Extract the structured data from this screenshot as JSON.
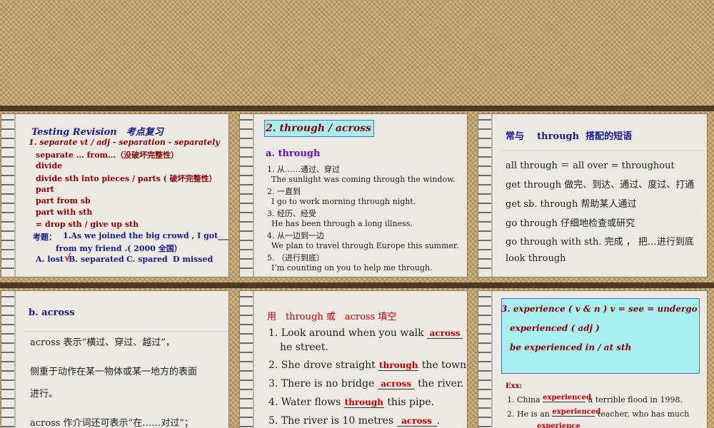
{
  "slides": {
    "s1": {
      "title": "Testing Revision　考点复习",
      "line1": "1. separate vt  / adj     - separation - separately",
      "line2": "separate … from…（没破坏完整性）",
      "line3": "divide",
      "line4": "divide sth into pieces / parts ( 破坏完整性）",
      "line5": "part",
      "line6": "part from sb",
      "line7": "part with sth",
      "line8": "= drop sth / give up sth",
      "q_label": "考题：",
      "q_text": "1.As we joined the big crowd , I got______",
      "q_text2": "from my friend .( 2000  全国）",
      "options": [
        "A. lost",
        "B. separated",
        "C. spared",
        "D missed"
      ],
      "check": "√"
    },
    "s2": {
      "title": "2. through / across",
      "sub": "a.  through",
      "items": [
        "1.  从……通过、穿过",
        "The sunlight was coming through the window.",
        "2.  一直到",
        "I go to work morning through night.",
        "3.  经历、经受",
        "He has been through a long illness.",
        "4.  从一边到一边",
        "We plan to travel through Europe this summer.",
        "5.  （进行到底）",
        "I’m counting on you to help me through."
      ]
    },
    "s3": {
      "title_a": "常与",
      "title_b": "through",
      "title_c": "搭配的短语",
      "items": [
        "all through ＝ all over = throughout",
        "get through  做完、到达、通过、度过、打通",
        "get sb. through  帮助某人通过",
        "go through  仔细地检查或研究",
        "go through with sth.  完成 ， 把…进行到底",
        "look through"
      ]
    },
    "s4": {
      "title": "b.  across",
      "p1": "across 表示“横过、穿过、越过”，",
      "p2": "侧重于动作在某一物体或某一地方的表面",
      "p3": "进行。",
      "p4": "across  作介词还可表示“在……对过”；"
    },
    "s5": {
      "title": "用　through  或　across  填空",
      "q1a": "1. Look around when you walk",
      "q1ans": "across",
      "q1b": "t",
      "q1c": "he street.",
      "q2a": "2. She drove straight",
      "q2ans": "through",
      "q2b": "the town.",
      "q3a": "3. There is no bridge",
      "q3ans": "across",
      "q3b": "the river.",
      "q4a": "4. Water flows",
      "q4ans": "through",
      "q4b": "this pipe.",
      "q5a": "5. The river is 10 metres",
      "q5ans": "across",
      "q5b": "."
    },
    "s6": {
      "line1": "3. experience  ( v  &  n ) v = see =  undergo",
      "line2": "experienced  ( adj )",
      "line3": "be experienced in / at sth",
      "exx": "Exx:",
      "e1a": "1. China",
      "e1ans": "experienced",
      "e1b": "a terrible flood in 1998.",
      "e2a": "2. He is an",
      "e2ans": "experienced",
      "e2b": "teacher, who has much",
      "e3ans": "experience"
    }
  },
  "colors": {
    "navy": "#1a1a8c",
    "darkred": "#8b0000",
    "cyan": "#a8f0f0"
  }
}
